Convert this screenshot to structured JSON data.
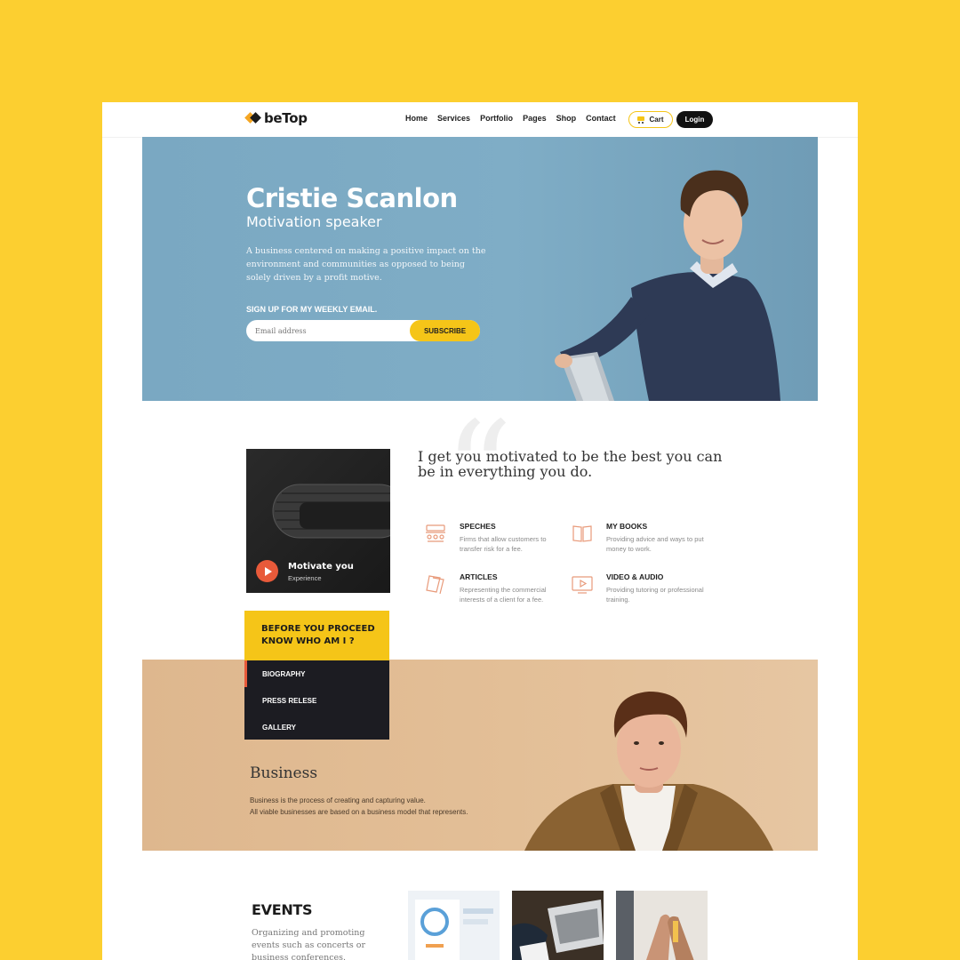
{
  "header": {
    "logo_text": "beTop",
    "nav": [
      "Home",
      "Services",
      "Portfolio",
      "Pages",
      "Shop",
      "Contact"
    ],
    "cart_label": "Cart",
    "login_label": "Login"
  },
  "hero": {
    "name": "Cristie Scanlon",
    "role": "Motivation speaker",
    "description": "A business centered on making a positive impact on the environment and communities as opposed to being solely driven by a profit motive.",
    "signup_label": "SIGN UP FOR MY WEEKLY EMAIL.",
    "email_placeholder": "Email address",
    "subscribe_label": "SUBSCRIBE"
  },
  "video": {
    "title": "Motivate you",
    "subtitle": "Experience"
  },
  "quote": "I get you motivated to be the best you can be in everything you do.",
  "features": [
    {
      "title": "SPECHES",
      "desc": "Firms that allow customers to transfer risk for a fee.",
      "icon": "speech-icon"
    },
    {
      "title": "MY BOOKS",
      "desc": "Providing advice and ways to put money to work.",
      "icon": "book-icon"
    },
    {
      "title": "ARTICLES",
      "desc": "Representing the commercial interests of a client for a fee.",
      "icon": "article-icon"
    },
    {
      "title": "VIDEO & AUDIO",
      "desc": "Providing tutoring or professional training.",
      "icon": "video-icon"
    }
  ],
  "about": {
    "heading_line1": "BEFORE YOU PROCEED",
    "heading_line2": "KNOW WHO AM I ?",
    "items": [
      "BIOGRAPHY",
      "PRESS RELESE",
      "GALLERY"
    ]
  },
  "business": {
    "title": "Business",
    "line1": "Business is the process of creating and capturing value.",
    "line2": "All viable businesses are based on a business model that represents."
  },
  "events": {
    "title": "EVENTS",
    "description": "Organizing and promoting events such as concerts or business conferences."
  },
  "colors": {
    "background": "#fccf30",
    "accent_yellow": "#f5c518",
    "accent_orange": "#e85a3a",
    "dark": "#1c1c22",
    "hero_blue": "#7aa8c2",
    "business_tan": "#deb78e"
  }
}
